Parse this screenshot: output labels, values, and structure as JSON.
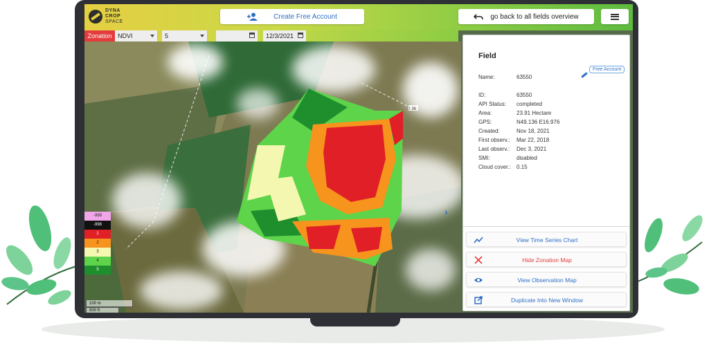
{
  "header": {
    "logo_line1": "DYNA",
    "logo_line2": "CROP",
    "logo_line3": "SPACE",
    "create_account_label": "Create Free Account",
    "back_label": "go back to all fields overview"
  },
  "controls": {
    "zonation_label": "Zonation",
    "index_value": "NDVI",
    "zones_value": "5",
    "date_from_value": "",
    "date_to_value": "12/3/2021"
  },
  "legend": {
    "items": [
      {
        "label": "-999",
        "color": "#f0a6e8"
      },
      {
        "label": "-998",
        "color": "#111111"
      },
      {
        "label": "1",
        "color": "#e11f26"
      },
      {
        "label": "2",
        "color": "#f7941d"
      },
      {
        "label": "3",
        "color": "#f4f7b0"
      },
      {
        "label": "4",
        "color": "#5dd44a"
      },
      {
        "label": "5",
        "color": "#1f8f2e"
      }
    ],
    "scale_m": "100 m",
    "scale_ft": "500 ft"
  },
  "map": {
    "road_label": "I 36"
  },
  "panel": {
    "title": "Field",
    "free_badge": "Free Account",
    "fields": [
      {
        "key": "Name:",
        "value": "63550"
      },
      {
        "key": "ID:",
        "value": "63550"
      },
      {
        "key": "API Status:",
        "value": "completed"
      },
      {
        "key": "Area:",
        "value": "23.91 Hectare"
      },
      {
        "key": "GPS:",
        "value": "N49.136 E16.976"
      },
      {
        "key": "Created:",
        "value": "Nov 18, 2021"
      },
      {
        "key": "First observ.:",
        "value": "Mar 22, 2018"
      },
      {
        "key": "Last observ.:",
        "value": "Dec 3, 2021"
      },
      {
        "key": "SMI:",
        "value": "disabled"
      },
      {
        "key": "Cloud cover.:",
        "value": "0.15"
      }
    ],
    "actions": [
      {
        "label": "View Time Series Chart",
        "icon": "chart-line-icon"
      },
      {
        "label": "Hide Zonation Map",
        "icon": "close-x-icon"
      },
      {
        "label": "View Observation Map",
        "icon": "eye-icon"
      },
      {
        "label": "Duplicate Into New Window",
        "icon": "open-external-icon"
      }
    ]
  },
  "colors": {
    "brand_yellow": "#e5cf42",
    "brand_green": "#5dbb3f",
    "accent_blue": "#2f6fc4",
    "alert_red": "#e43c3c"
  }
}
